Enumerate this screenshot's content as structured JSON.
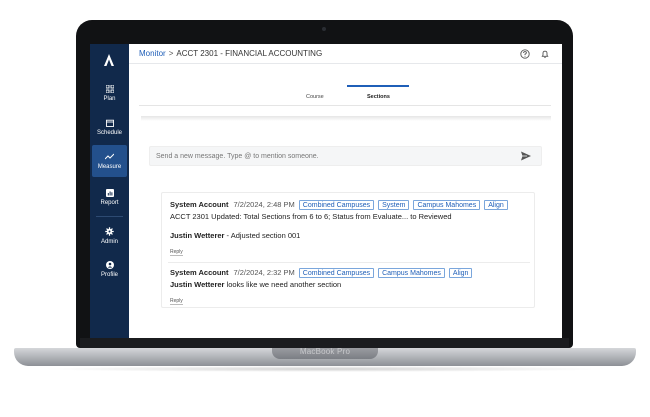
{
  "device": {
    "model_label": "MacBook Pro"
  },
  "sidebar": {
    "items": [
      {
        "label": "Plan",
        "icon": "grid-icon"
      },
      {
        "label": "Schedule",
        "icon": "calendar-icon"
      },
      {
        "label": "Measure",
        "icon": "trend-icon",
        "active": true
      },
      {
        "label": "Report",
        "icon": "report-icon"
      },
      {
        "label": "Admin",
        "icon": "gear-icon"
      },
      {
        "label": "Profile",
        "icon": "user-icon"
      }
    ]
  },
  "header": {
    "breadcrumb_link": "Monitor",
    "breadcrumb_sep": ">",
    "breadcrumb_current": "ACCT 2301 - FINANCIAL ACCOUNTING"
  },
  "tabs": [
    {
      "label": "Course"
    },
    {
      "label": "Sections",
      "active": true
    }
  ],
  "composer": {
    "placeholder": "Send a new message. Type @ to mention someone."
  },
  "feed": [
    {
      "author": "System Account",
      "time": "7/2/2024, 2:48 PM",
      "tags": [
        "Combined Campuses",
        "System",
        "Campus Mahomes",
        "Align"
      ],
      "body": "ACCT 2301 Updated: Total Sections from 6 to 6; Status from Evaluate... to Reviewed",
      "reply_author": "Justin Wetterer",
      "reply_text": " - Adjusted section 001",
      "reply_label": "Reply"
    },
    {
      "author": "System Account",
      "time": "7/2/2024, 2:32 PM",
      "tags": [
        "Combined Campuses",
        "Campus Mahomes",
        "Align"
      ],
      "body_author": "Justin Wetterer",
      "body_text": " looks like we need another section",
      "reply_label": "Reply"
    }
  ],
  "colors": {
    "sidebar": "#11294b",
    "active": "#23508c",
    "link": "#1f5fb8"
  }
}
